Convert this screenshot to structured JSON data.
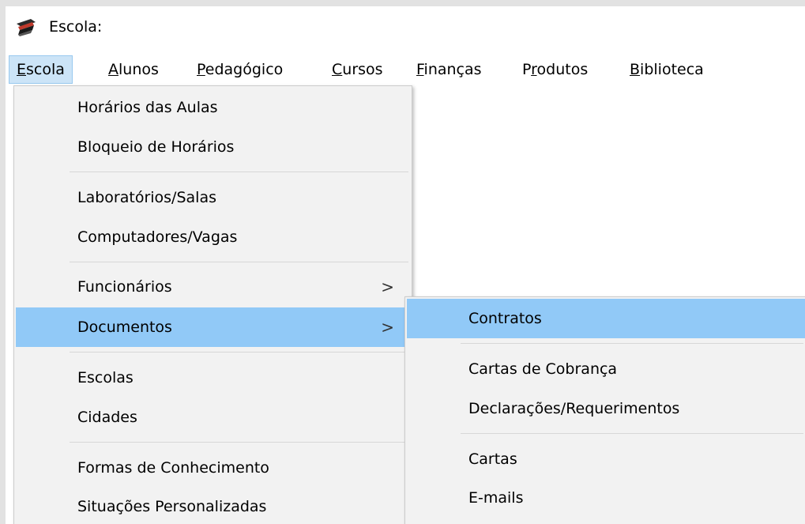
{
  "window": {
    "title": "Escola:"
  },
  "menubar": [
    {
      "before": "",
      "key": "E",
      "after": "scola",
      "active": true
    },
    {
      "before": "",
      "key": "A",
      "after": "lunos"
    },
    {
      "before": "",
      "key": "P",
      "after": "edagógico"
    },
    {
      "before": "",
      "key": "C",
      "after": "ursos"
    },
    {
      "before": "",
      "key": "F",
      "after": "inanças"
    },
    {
      "before": "P",
      "key": "r",
      "after": "odutos"
    },
    {
      "before": "",
      "key": "B",
      "after": "iblioteca"
    }
  ],
  "escola_menu": {
    "items": [
      {
        "label": "Horários das Aulas"
      },
      {
        "label": "Bloqueio de Horários"
      },
      {
        "label": "Laboratórios/Salas"
      },
      {
        "label": "Computadores/Vagas"
      },
      {
        "label": "Funcionários",
        "arrow": ">"
      },
      {
        "label": "Documentos",
        "arrow": ">",
        "highlighted": true
      },
      {
        "label": "Escolas"
      },
      {
        "label": "Cidades"
      },
      {
        "label": "Formas de Conhecimento"
      },
      {
        "label": "Situações Personalizadas"
      }
    ]
  },
  "documentos_submenu": {
    "items": [
      {
        "label": "Contratos",
        "highlighted": true
      },
      {
        "label": "Cartas de Cobrança"
      },
      {
        "label": "Declarações/Requerimentos"
      },
      {
        "label": "Cartas"
      },
      {
        "label": "E-mails"
      }
    ]
  },
  "colors": {
    "highlight": "#91c9f7",
    "menu_background": "#f2f2f2",
    "menubar_active": "#cce4f7"
  }
}
